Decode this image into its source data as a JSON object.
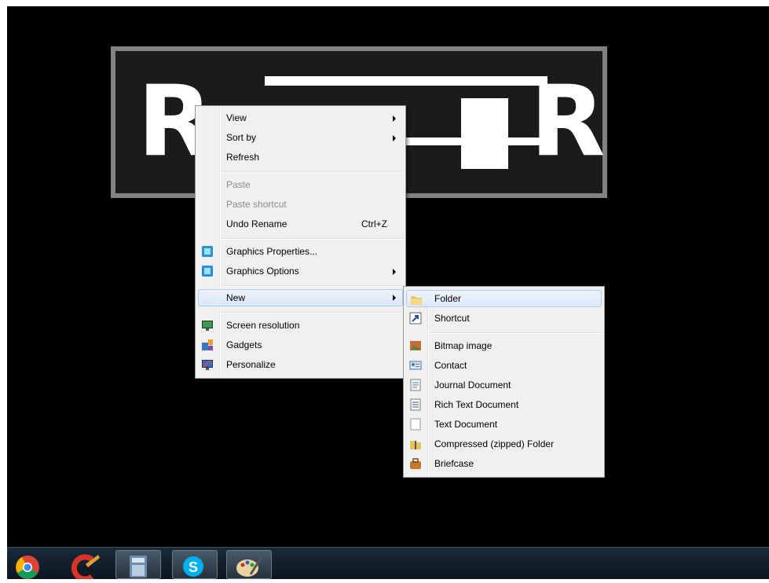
{
  "context_menu": {
    "items": [
      {
        "label": "View"
      },
      {
        "label": "Sort by"
      },
      {
        "label": "Refresh"
      },
      {
        "label": "Paste"
      },
      {
        "label": "Paste shortcut"
      },
      {
        "label": "Undo Rename",
        "shortcut": "Ctrl+Z"
      },
      {
        "label": "Graphics Properties..."
      },
      {
        "label": "Graphics Options"
      },
      {
        "label": "New"
      },
      {
        "label": "Screen resolution"
      },
      {
        "label": "Gadgets"
      },
      {
        "label": "Personalize"
      }
    ]
  },
  "new_submenu": {
    "items": [
      {
        "label": "Folder"
      },
      {
        "label": "Shortcut"
      },
      {
        "label": "Bitmap image"
      },
      {
        "label": "Contact"
      },
      {
        "label": "Journal Document"
      },
      {
        "label": "Rich Text Document"
      },
      {
        "label": "Text Document"
      },
      {
        "label": "Compressed (zipped) Folder"
      },
      {
        "label": "Briefcase"
      }
    ]
  },
  "taskbar": {
    "apps": [
      "chrome-icon",
      "ccleaner-icon",
      "calculator-icon",
      "skype-icon",
      "paint-icon"
    ]
  },
  "colors": {
    "desktop_bg": "#000000",
    "menu_bg": "#f0f0f0",
    "highlight": "#dce8f8"
  }
}
